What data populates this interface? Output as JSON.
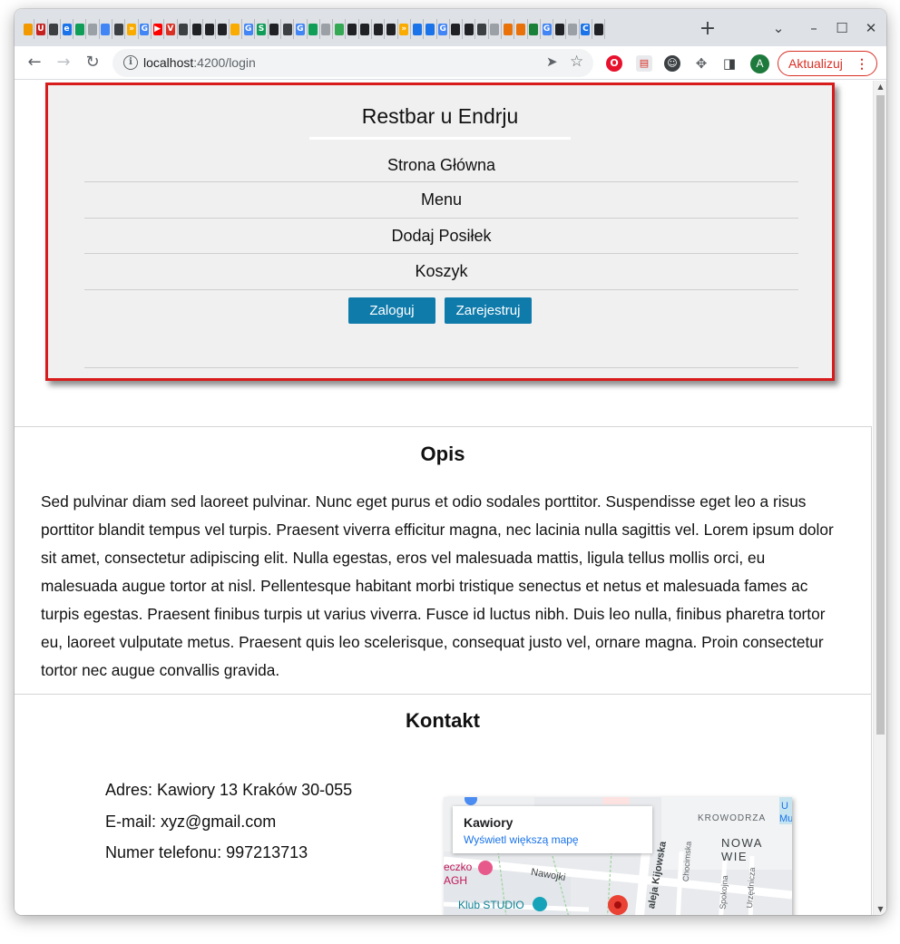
{
  "browser": {
    "tab_favicons": [
      {
        "icon": "flame-icon",
        "color": "#f29900",
        "glyph": ""
      },
      {
        "icon": "u-icon",
        "color": "#c5221f",
        "glyph": "U"
      },
      {
        "icon": "circle-icon",
        "color": "#3c4043",
        "glyph": ""
      },
      {
        "icon": "e-icon",
        "color": "#1a73e8",
        "glyph": "e"
      },
      {
        "icon": "arc-icon",
        "color": "#0f9d58",
        "glyph": ""
      },
      {
        "icon": "doc-icon",
        "color": "#9aa0a6",
        "glyph": ""
      },
      {
        "icon": "person-icon",
        "color": "#4285f4",
        "glyph": ""
      },
      {
        "icon": "bars-icon",
        "color": "#3c4043",
        "glyph": ""
      },
      {
        "icon": "chevron-icon",
        "color": "#f9ab00",
        "glyph": "»"
      },
      {
        "icon": "g-icon",
        "color": "#4285f4",
        "glyph": "G"
      },
      {
        "icon": "play-icon",
        "color": "#ff0000",
        "glyph": "▶"
      },
      {
        "icon": "v-icon",
        "color": "#d93025",
        "glyph": "V"
      },
      {
        "icon": "bars-icon",
        "color": "#3c4043",
        "glyph": ""
      },
      {
        "icon": "github-icon",
        "color": "#202124",
        "glyph": ""
      },
      {
        "icon": "github-icon",
        "color": "#202124",
        "glyph": ""
      },
      {
        "icon": "github-icon",
        "color": "#202124",
        "glyph": ""
      },
      {
        "icon": "hand-icon",
        "color": "#f9ab00",
        "glyph": ""
      },
      {
        "icon": "g-icon",
        "color": "#4285f4",
        "glyph": "G"
      },
      {
        "icon": "s-icon",
        "color": "#0f9d58",
        "glyph": "S"
      },
      {
        "icon": "github-icon",
        "color": "#202124",
        "glyph": ""
      },
      {
        "icon": "bars-icon",
        "color": "#3c4043",
        "glyph": ""
      },
      {
        "icon": "g-icon",
        "color": "#4285f4",
        "glyph": "G"
      },
      {
        "icon": "stack-icon",
        "color": "#0f9d58",
        "glyph": ""
      },
      {
        "icon": "search-icon",
        "color": "#9aa0a6",
        "glyph": ""
      },
      {
        "icon": "leaf-icon",
        "color": "#34a853",
        "glyph": ""
      },
      {
        "icon": "github-icon",
        "color": "#202124",
        "glyph": ""
      },
      {
        "icon": "github-icon",
        "color": "#202124",
        "glyph": ""
      },
      {
        "icon": "github-icon",
        "color": "#202124",
        "glyph": ""
      },
      {
        "icon": "github-icon",
        "color": "#202124",
        "glyph": ""
      },
      {
        "icon": "chevron-icon",
        "color": "#f9ab00",
        "glyph": "»"
      },
      {
        "icon": "list-icon",
        "color": "#1a73e8",
        "glyph": ""
      },
      {
        "icon": "list-icon",
        "color": "#1a73e8",
        "glyph": ""
      },
      {
        "icon": "g-icon",
        "color": "#4285f4",
        "glyph": "G"
      },
      {
        "icon": "github-icon",
        "color": "#202124",
        "glyph": ""
      },
      {
        "icon": "github-icon",
        "color": "#202124",
        "glyph": ""
      },
      {
        "icon": "bars-icon",
        "color": "#3c4043",
        "glyph": ""
      },
      {
        "icon": "dot-icon",
        "color": "#9aa0a6",
        "glyph": ""
      },
      {
        "icon": "bracket-icon",
        "color": "#e8710a",
        "glyph": ""
      },
      {
        "icon": "book-icon",
        "color": "#e8710a",
        "glyph": ""
      },
      {
        "icon": "globe-icon",
        "color": "#188038",
        "glyph": ""
      },
      {
        "icon": "g-icon",
        "color": "#4285f4",
        "glyph": "G"
      },
      {
        "icon": "github-icon",
        "color": "#202124",
        "glyph": ""
      },
      {
        "icon": "search-icon",
        "color": "#9aa0a6",
        "glyph": ""
      },
      {
        "icon": "c-icon",
        "color": "#1a73e8",
        "glyph": "C"
      },
      {
        "icon": "github-icon",
        "color": "#202124",
        "glyph": ""
      }
    ],
    "new_tab_glyph": "+",
    "url_host": "localhost",
    "url_path": ":4200/login",
    "profile_initial": "A",
    "update_label": "Aktualizuj"
  },
  "page": {
    "site_title": "Restbar u Endrju",
    "nav": [
      "Strona Główna",
      "Menu",
      "Dodaj Posiłek",
      "Koszyk"
    ],
    "login_label": "Zaloguj",
    "register_label": "Zarejestruj",
    "opis_title": "Opis",
    "opis_text": "Sed pulvinar diam sed laoreet pulvinar. Nunc eget purus et odio sodales porttitor. Suspendisse eget leo a risus porttitor blandit tempus vel turpis. Praesent viverra efficitur magna, nec lacinia nulla sagittis vel. Lorem ipsum dolor sit amet, consectetur adipiscing elit. Nulla egestas, eros vel malesuada mattis, ligula tellus mollis orci, eu malesuada augue tortor at nisl. Pellentesque habitant morbi tristique senectus et netus et malesuada fames ac turpis egestas. Praesent finibus turpis ut varius viverra. Fusce id luctus nibh. Duis leo nulla, finibus pharetra tortor eu, laoreet vulputate metus. Praesent quis leo scelerisque, consequat justo vel, ornare magna. Proin consectetur tortor nec augue convallis gravida.",
    "kontakt_title": "Kontakt",
    "address": "Adres: Kawiory 13 Kraków 30-055",
    "email": "E-mail: xyz@gmail.com",
    "phone": "Numer telefonu: 997213713",
    "map": {
      "place": "Kawiory",
      "link": "Wyświetl większą mapę",
      "labels": {
        "krowodrza": "KROWODRZA",
        "nowa_wies": "NOWA WIE",
        "nawojki": "Nawojki",
        "kijowska": "aleja Kijowska",
        "chocimska": "Chocimska",
        "spokojna": "Spokojna",
        "urzednicza": "Urzędnicza",
        "agh_line1": "eczko",
        "agh_line2": "AGH",
        "klub": "Klub STUDIO",
        "mu_line1": "U",
        "mu_line2": "Mu"
      }
    }
  }
}
